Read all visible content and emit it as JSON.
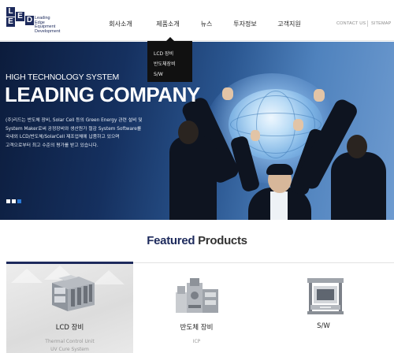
{
  "header": {
    "logo": {
      "letters": [
        "L",
        "E",
        "E",
        "D"
      ],
      "lines": [
        "Leading",
        "Edge",
        "Equipment",
        "Development"
      ]
    },
    "nav": [
      {
        "label": "회사소개"
      },
      {
        "label": "제품소개"
      },
      {
        "label": "뉴스"
      },
      {
        "label": "투자정보"
      },
      {
        "label": "고객지원"
      }
    ],
    "dropdown": [
      "LCD 장비",
      "반도체장비",
      "S/W"
    ],
    "util": {
      "contact": "CONTACT US",
      "sitemap": "SITEMAP"
    }
  },
  "hero": {
    "subtitle": "HIGH TECHNOLOGY SYSTEM",
    "title": "LEADING COMPANY",
    "description": [
      "(주)리드는 반도체 장비, Solar Cell 등의 Green Energy 관련 설비 및",
      "System Maker로써 공정장비와 생산원가 절감 System Software를",
      "국내외 LCD/반도체/SolarCell 제조업체에 납품하고 있으며",
      "고객으로부터 최고 수준의 평가를 받고 있습니다."
    ],
    "slides": 3,
    "active_slide": 3
  },
  "featured": {
    "title_part1": "Featured",
    "title_part2": " Products",
    "products": [
      {
        "name": "LCD 장비",
        "sub": [
          "Thermal Control Unit",
          "UV Cure System"
        ]
      },
      {
        "name": "반도체 장비",
        "sub": [
          "ICP"
        ]
      },
      {
        "name": "S/W",
        "sub": []
      }
    ]
  },
  "colors": {
    "brand": "#1d2a5c",
    "accent": "#2a7ad8"
  }
}
